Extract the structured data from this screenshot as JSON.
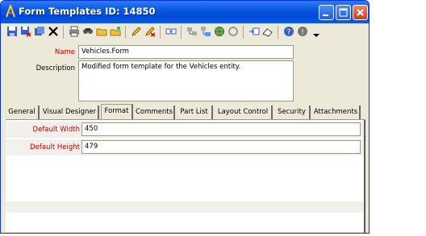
{
  "window": {
    "title": "Form Templates ID: 14850"
  },
  "toolbar": {
    "icons": [
      "save-icon",
      "save-close-icon",
      "copy-record-icon",
      "delete-icon",
      "print-icon",
      "find-icon",
      "open-folder-icon",
      "new-folder-icon",
      "edit-icon",
      "undo-icon",
      "link-icon",
      "related-icon",
      "hierarchy-icon",
      "web-icon",
      "refresh-icon",
      "add-item-icon",
      "eraser-icon",
      "help-icon",
      "info-icon",
      "dropdown-arrow-icon"
    ]
  },
  "form": {
    "name_label": "Name",
    "name_value": "Vehicles.Form",
    "description_label": "Description",
    "description_value": "Modified form template for the Vehicles entity."
  },
  "tabs": [
    {
      "label": "General",
      "active": false
    },
    {
      "label": "Visual Designer",
      "active": false
    },
    {
      "label": "Format",
      "active": true
    },
    {
      "label": "Comments",
      "active": false
    },
    {
      "label": "Part List",
      "active": false
    },
    {
      "label": "Layout Control",
      "active": false
    },
    {
      "label": "Security",
      "active": false
    },
    {
      "label": "Attachments",
      "active": false
    }
  ],
  "format": {
    "default_width_label": "Default Width",
    "default_width_value": "450",
    "default_height_label": "Default Height",
    "default_height_value": "479"
  },
  "colors": {
    "title_bar": "#0a58e0",
    "required_label": "#c00000",
    "window_face": "#ece9d8"
  }
}
